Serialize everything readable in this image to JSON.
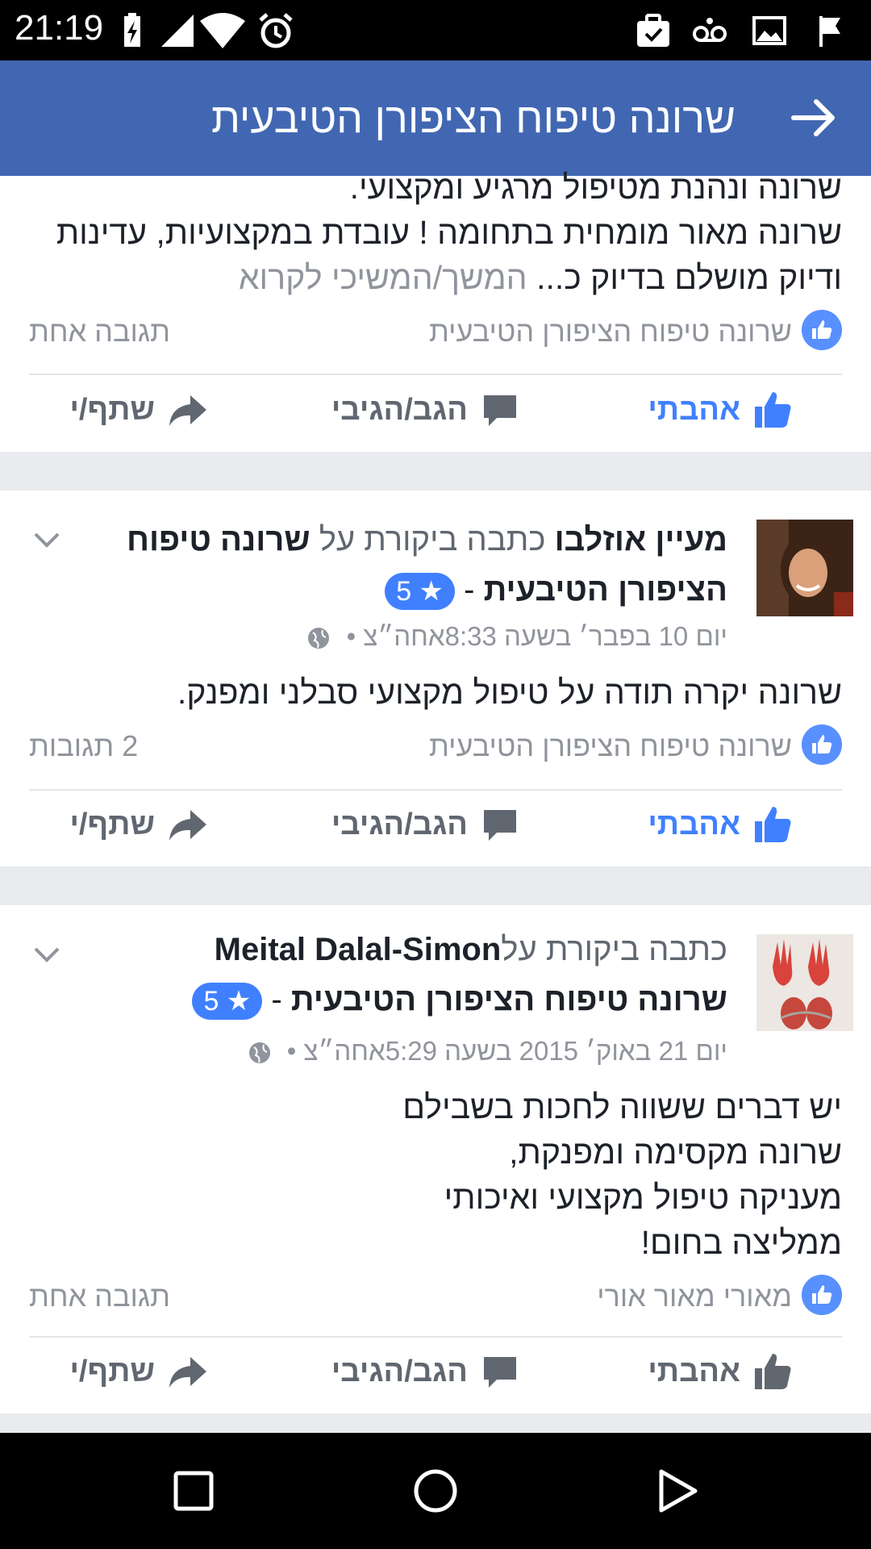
{
  "status_bar": {
    "time": "21:19"
  },
  "header": {
    "title": "שרונה טיפוח הציפורן הטיבעית"
  },
  "post1": {
    "lines": [
      "שרונה ונהנת מטיפול מרגיע ומקצועי.",
      "שרונה מאור מומחית בתחומה ! עובדת במקצועיות, עדינות",
      "ודיוק מושלם בדיוק כ..."
    ],
    "read_more": "המשך/המשיכי לקרוא",
    "likes_text": "שרונה טיפוח הציפורן הטיבעית",
    "comments_text": "תגובה אחת"
  },
  "post2": {
    "author": "מעיין אוזלבו",
    "verb": "כתבה ביקורת על",
    "page_name": "שרונה טיפוח הציפורן הטיבעית",
    "dash": "-",
    "rating": "5 ★",
    "meta": "יום 10 בפבר׳ בשעה 8:33אחה״צ •",
    "body": "שרונה יקרה תודה על טיפול מקצועי סבלני ומפנק.",
    "likes_text": "שרונה טיפוח הציפורן הטיבעית",
    "comments_text": "2 תגובות"
  },
  "post3": {
    "author": "Meital Dalal-Simon",
    "verb": "כתבה ביקורת על",
    "page_name": "שרונה טיפוח הציפורן הטיבעית",
    "dash": "-",
    "rating": "5 ★",
    "meta": "יום 21 באוק׳ 2015 בשעה 5:29אחה״צ •",
    "body_lines": [
      "יש דברים ששווה לחכות בשבילם",
      "שרונה מקסימה ומפנקת,",
      "מעניקה טיפול מקצועי ואיכותי",
      "ממליצה בחום!"
    ],
    "likes_text": "מאורי מאור אורי",
    "comments_text": "תגובה אחת"
  },
  "actions": {
    "like": "אהבתי",
    "comment": "הגב/הגיבי",
    "share": "שתף/י"
  },
  "colors": {
    "header": "#4267b2",
    "like_blue": "#4080ff",
    "muted": "#90949c"
  }
}
